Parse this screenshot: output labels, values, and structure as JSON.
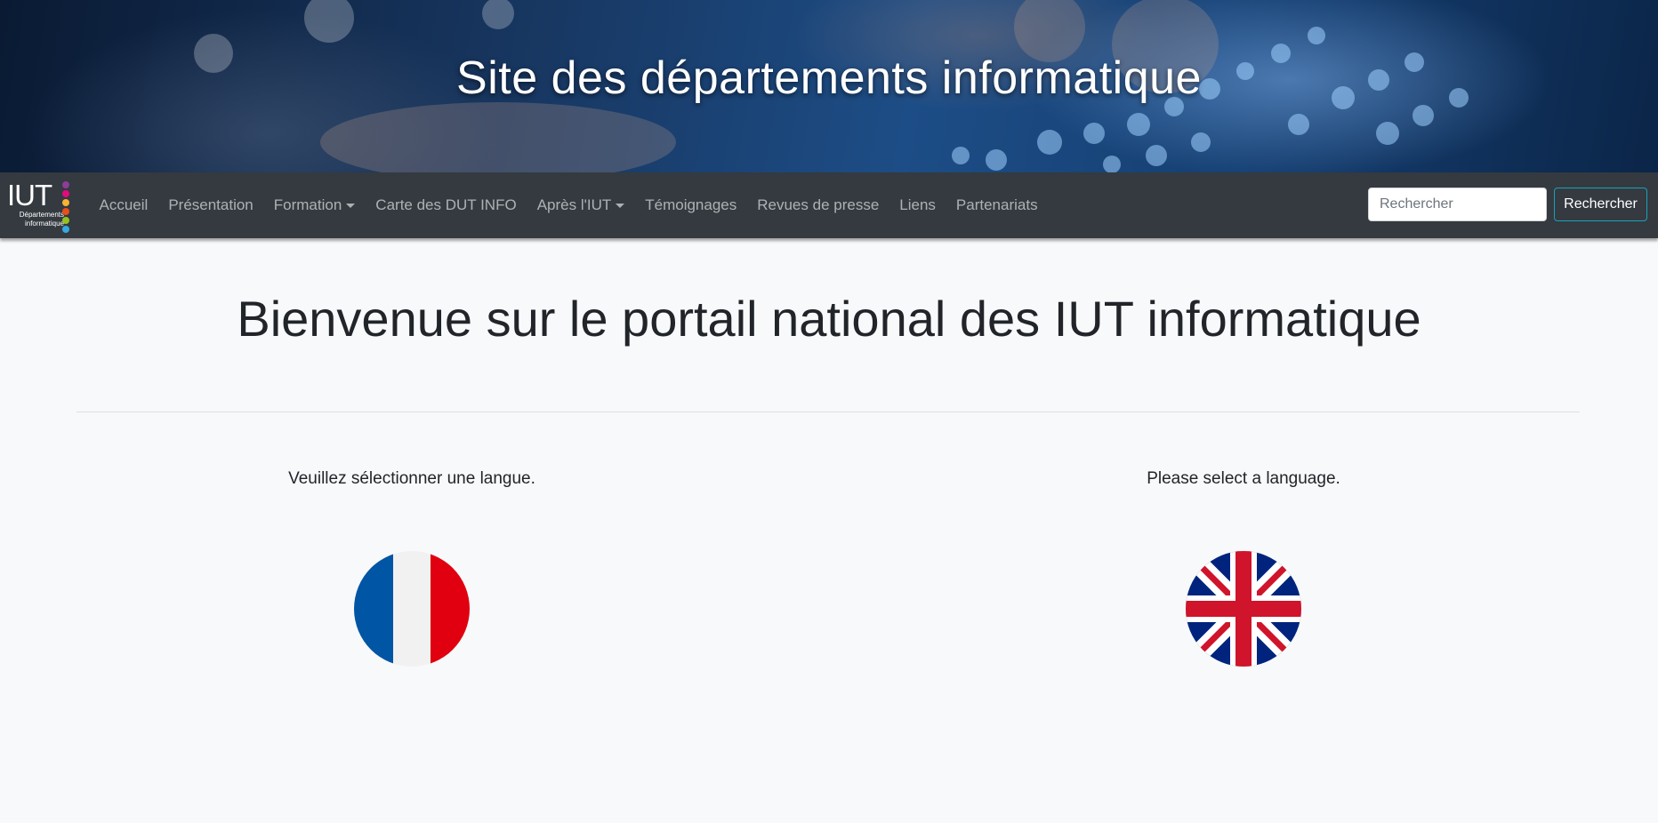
{
  "banner": {
    "title": "Site des départements informatique"
  },
  "navbar": {
    "logo": {
      "text": "IUT",
      "subtitle_line1": "Départements",
      "subtitle_line2": "informatique",
      "dot_colors": [
        "#8e3c97",
        "#e5097f",
        "#f9b233",
        "#e94e1b",
        "#95c11f",
        "#36a9e1"
      ]
    },
    "items": [
      {
        "label": "Accueil"
      },
      {
        "label": "Présentation"
      },
      {
        "label": "Formation",
        "dropdown": true
      },
      {
        "label": "Carte des DUT INFO"
      },
      {
        "label": "Après l'IUT",
        "dropdown": true
      },
      {
        "label": "Témoignages"
      },
      {
        "label": "Revues de presse"
      },
      {
        "label": "Liens"
      },
      {
        "label": "Partenariats"
      }
    ],
    "search": {
      "placeholder": "Rechercher",
      "value": "",
      "button_label": "Rechercher"
    }
  },
  "main": {
    "title": "Bienvenue sur le portail national des IUT informatique",
    "languages": [
      {
        "text": "Veuillez sélectionner une langue.",
        "flag": "france-flag-icon"
      },
      {
        "text": "Please select a language.",
        "flag": "uk-flag-icon"
      }
    ]
  },
  "colors": {
    "navbar_bg": "#343a40",
    "page_bg": "#f8f9fa",
    "search_button_border": "#17a2b8",
    "france_blue": "#0055a4",
    "france_red": "#e1000f",
    "uk_blue": "#00247d",
    "uk_red": "#cf142b"
  }
}
